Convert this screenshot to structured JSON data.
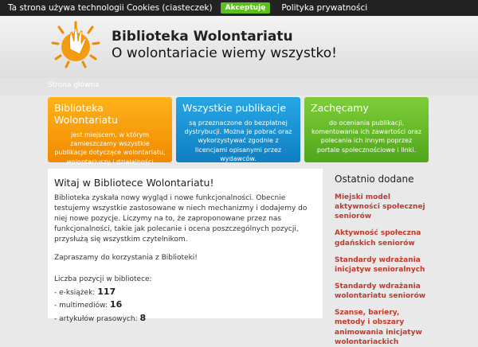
{
  "cookie": {
    "text": "Ta strona używa technologii Cookies (ciasteczek)",
    "accept": "Akceptuję",
    "privacy": "Polityka prywatności"
  },
  "header": {
    "title": "Biblioteka Wolontariatu",
    "tagline": "O wolontariacie wiemy wszystko!"
  },
  "nav": {
    "link": "Strona główna"
  },
  "boxes": [
    {
      "title": "Biblioteka Wolontariatu",
      "text": "jest miejscem, w którym zamieszczamy wszystkie publikacje dotyczące wolontariatu, wolontariuszy i działalności społecznej."
    },
    {
      "title": "Wszystkie publikacje",
      "text": "są przeznaczone do bezpłatnej dystrybucji. Można je pobrać oraz wykorzystywać zgodnie z licencjami opisanymi przez wydawców."
    },
    {
      "title": "Zachęcamy",
      "text": "do oceniania publikacji, komentowania ich zawartości oraz polecania ich innym poprzez portale społecznościowe i linki."
    }
  ],
  "main": {
    "title": "Witaj w Bibliotece Wolontariatu!",
    "intro": "Biblioteka zyskała nowy wygląd i nowe funkcjonalności. Obecnie testujemy wszystkie zastosowane w niech mechanizmy i dodajemy do niej nowe pozycje. Liczymy na to, że zaproponowane przez nas funkcjonalności, takie jak polecanie i ocena poszczególnych pozycji, przysłużą się wszystkim czytelnikom.",
    "invite": "Zapraszamy do korzystania z Biblioteki!",
    "stats_title": "Liczba pozycji w bibliotece:",
    "stats": [
      {
        "label": "- e-książek:",
        "value": "117"
      },
      {
        "label": "- multimediów:",
        "value": "16"
      },
      {
        "label": "- artykułów prasowych:",
        "value": "8"
      }
    ]
  },
  "sidebar": {
    "title": "Ostatnio dodane",
    "items": [
      "Miejski model aktywności społecznej seniorów",
      "Aktywność społeczna gdańskich seniorów",
      "Standardy wdrażania inicjatyw senioralnych",
      "Standardy wdrażania wolontariatu seniorów",
      "Szanse, bariery, metody i obszary animowania inicjatyw wolontariackich"
    ]
  }
}
